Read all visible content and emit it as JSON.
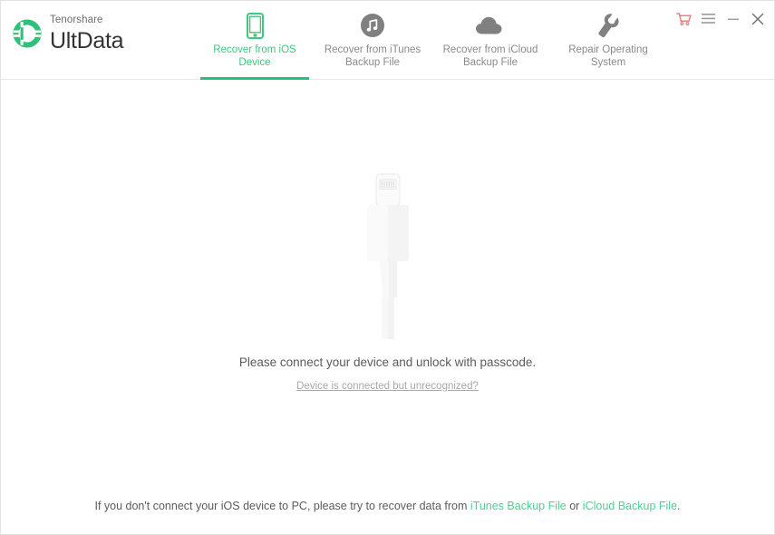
{
  "window": {
    "brand_top": "Tenorshare",
    "brand_name": "UltData",
    "logo_icon": "ultdata-ring-logo",
    "controls": [
      {
        "name": "cart-icon",
        "label": "Buy",
        "color": "#f08080"
      },
      {
        "name": "menu-icon",
        "label": "Menu",
        "color": "#9a9a9a"
      },
      {
        "name": "minimize-icon",
        "label": "Minimize",
        "color": "#9a9a9a"
      },
      {
        "name": "close-icon",
        "label": "Close",
        "color": "#6e6e6e"
      }
    ]
  },
  "tabs": [
    {
      "id": "recover-from-ios-device",
      "label": "Recover from iOS\nDevice",
      "icon": "smartphone-icon",
      "active": true,
      "accent": "#3fc97f"
    },
    {
      "id": "recover-from-itunes-backup-file",
      "label": "Recover from iTunes\nBackup File",
      "icon": "itunes-music-note-icon",
      "active": false,
      "accent": "#808080"
    },
    {
      "id": "recover-from-icloud-backup-file",
      "label": "Recover from iCloud\nBackup File",
      "icon": "cloud-icon",
      "active": false,
      "accent": "#808080"
    },
    {
      "id": "repair-operating-system",
      "label": "Repair Operating\nSystem",
      "icon": "wrench-icon",
      "active": false,
      "accent": "#808080"
    }
  ],
  "main": {
    "illustration_icon": "lightning-cable-icon",
    "connect_message": "Please connect your device and unlock with passcode.",
    "unrecognized_link": "Device is connected but unrecognized?"
  },
  "footer": {
    "text_before": "If you don't connect your iOS device to PC, please try to recover data from ",
    "link_itunes": "iTunes Backup File",
    "text_between": " or ",
    "link_icloud": "iCloud Backup File",
    "text_after": "."
  },
  "colors": {
    "accent_green": "#24c176",
    "label_green": "#3fc97f",
    "link_green": "#4fd094",
    "gray_icon": "#808080",
    "cart_red": "#f08080"
  }
}
